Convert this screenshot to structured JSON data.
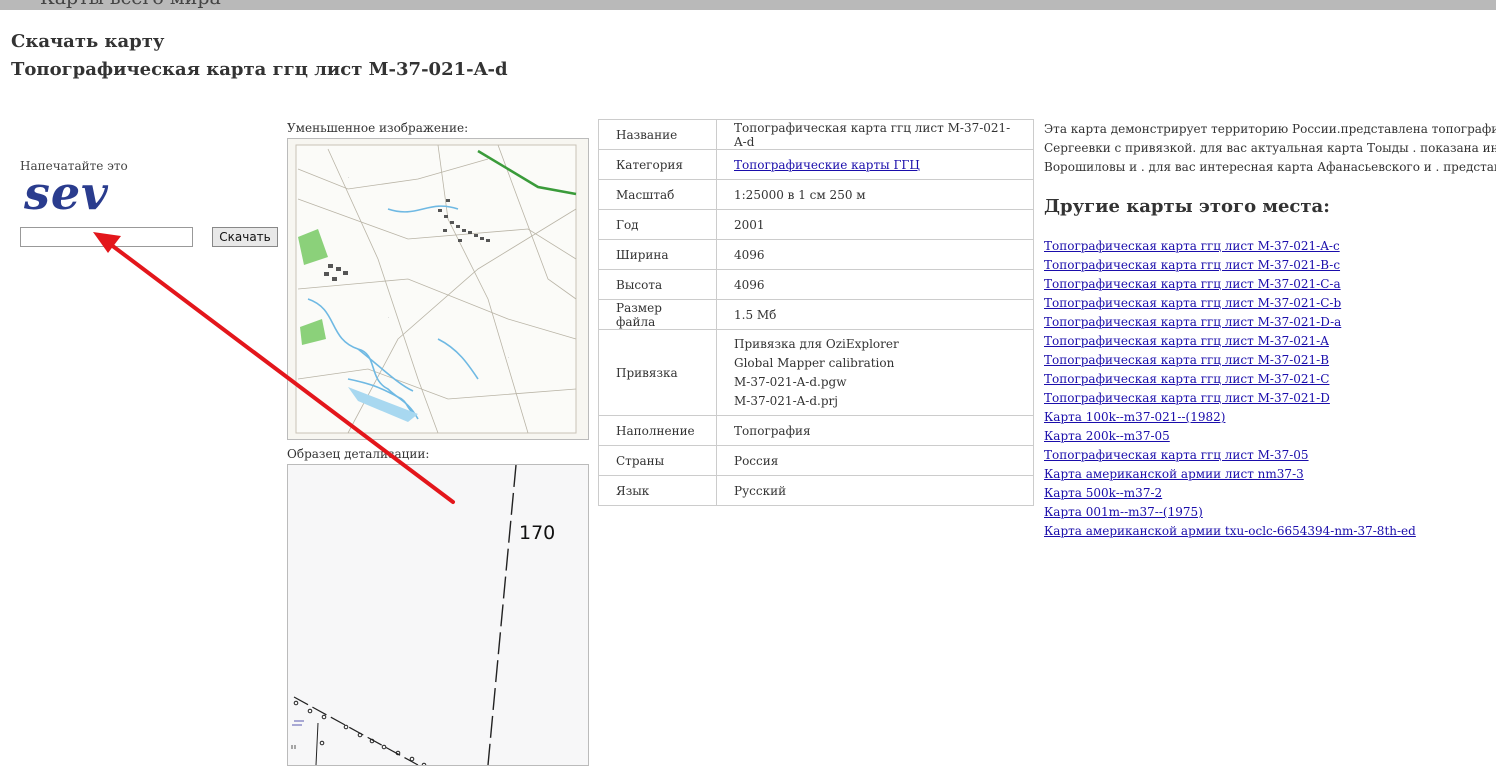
{
  "header": {
    "site_title": "Карты всего мира"
  },
  "page": {
    "title": "Скачать карту",
    "subtitle": "Топографическая карта ггц лист M-37-021-A-d"
  },
  "captcha": {
    "label": "Напечатайте это",
    "code": "sev",
    "input_value": "",
    "button_label": "Скачать"
  },
  "preview": {
    "thumb_label": "Уменьшенное изображение:",
    "detail_label": "Образец детализации:",
    "detail_number": "170"
  },
  "info_table": {
    "rows": [
      {
        "key": "Название",
        "value": "Топографическая карта ггц лист M-37-021-A-d"
      },
      {
        "key": "Категория",
        "value": "Топографические карты ГГЦ",
        "link": true
      },
      {
        "key": "Масштаб",
        "value": "1:25000 в 1 см 250 м"
      },
      {
        "key": "Год",
        "value": "2001"
      },
      {
        "key": "Ширина",
        "value": "4096"
      },
      {
        "key": "Высота",
        "value": "4096"
      },
      {
        "key": "Размер файла",
        "value": "1.5 Мб"
      },
      {
        "key": "Привязка",
        "lines": [
          "Привязка для OziExplorer",
          "Global Mapper calibration",
          "M-37-021-A-d.pgw",
          "M-37-021-A-d.prj"
        ]
      },
      {
        "key": "Наполнение",
        "value": "Топография"
      },
      {
        "key": "Страны",
        "value": "Россия"
      },
      {
        "key": "Язык",
        "value": "Русский"
      }
    ]
  },
  "description": {
    "lines": [
      "Эта карта демонстрирует территорию России.представлена топографическая",
      "Сергеевки с привязкой. для вас актуальная карта Тоыды . показана интересная",
      "Ворошиловы и . для вас интересная карта Афанасьевского и . представлена"
    ]
  },
  "other_maps": {
    "title": "Другие карты этого места:",
    "links": [
      "Топографическая карта ггц лист M-37-021-A-c",
      "Топографическая карта ггц лист M-37-021-B-c",
      "Топографическая карта ггц лист M-37-021-C-a",
      "Топографическая карта ггц лист M-37-021-C-b",
      "Топографическая карта ггц лист M-37-021-D-a",
      "Топографическая карта ггц лист M-37-021-A",
      "Топографическая карта ггц лист M-37-021-B",
      "Топографическая карта ггц лист M-37-021-C",
      "Топографическая карта ггц лист M-37-021-D",
      "Карта 100k--m37-021--(1982)",
      "Карта 200k--m37-05",
      "Топографическая карта ггц лист M-37-05",
      "Карта американской армии лист nm37-3",
      "Карта 500k--m37-2",
      "Карта 001m--m37--(1975)",
      "Карта американской армии txu-oclc-6654394-nm-37-8th-ed"
    ]
  },
  "colors": {
    "link": "#1a0dab",
    "arrow": "#e3161b",
    "captcha": "#2a3c8e",
    "topbar": "#b9b9b9"
  }
}
